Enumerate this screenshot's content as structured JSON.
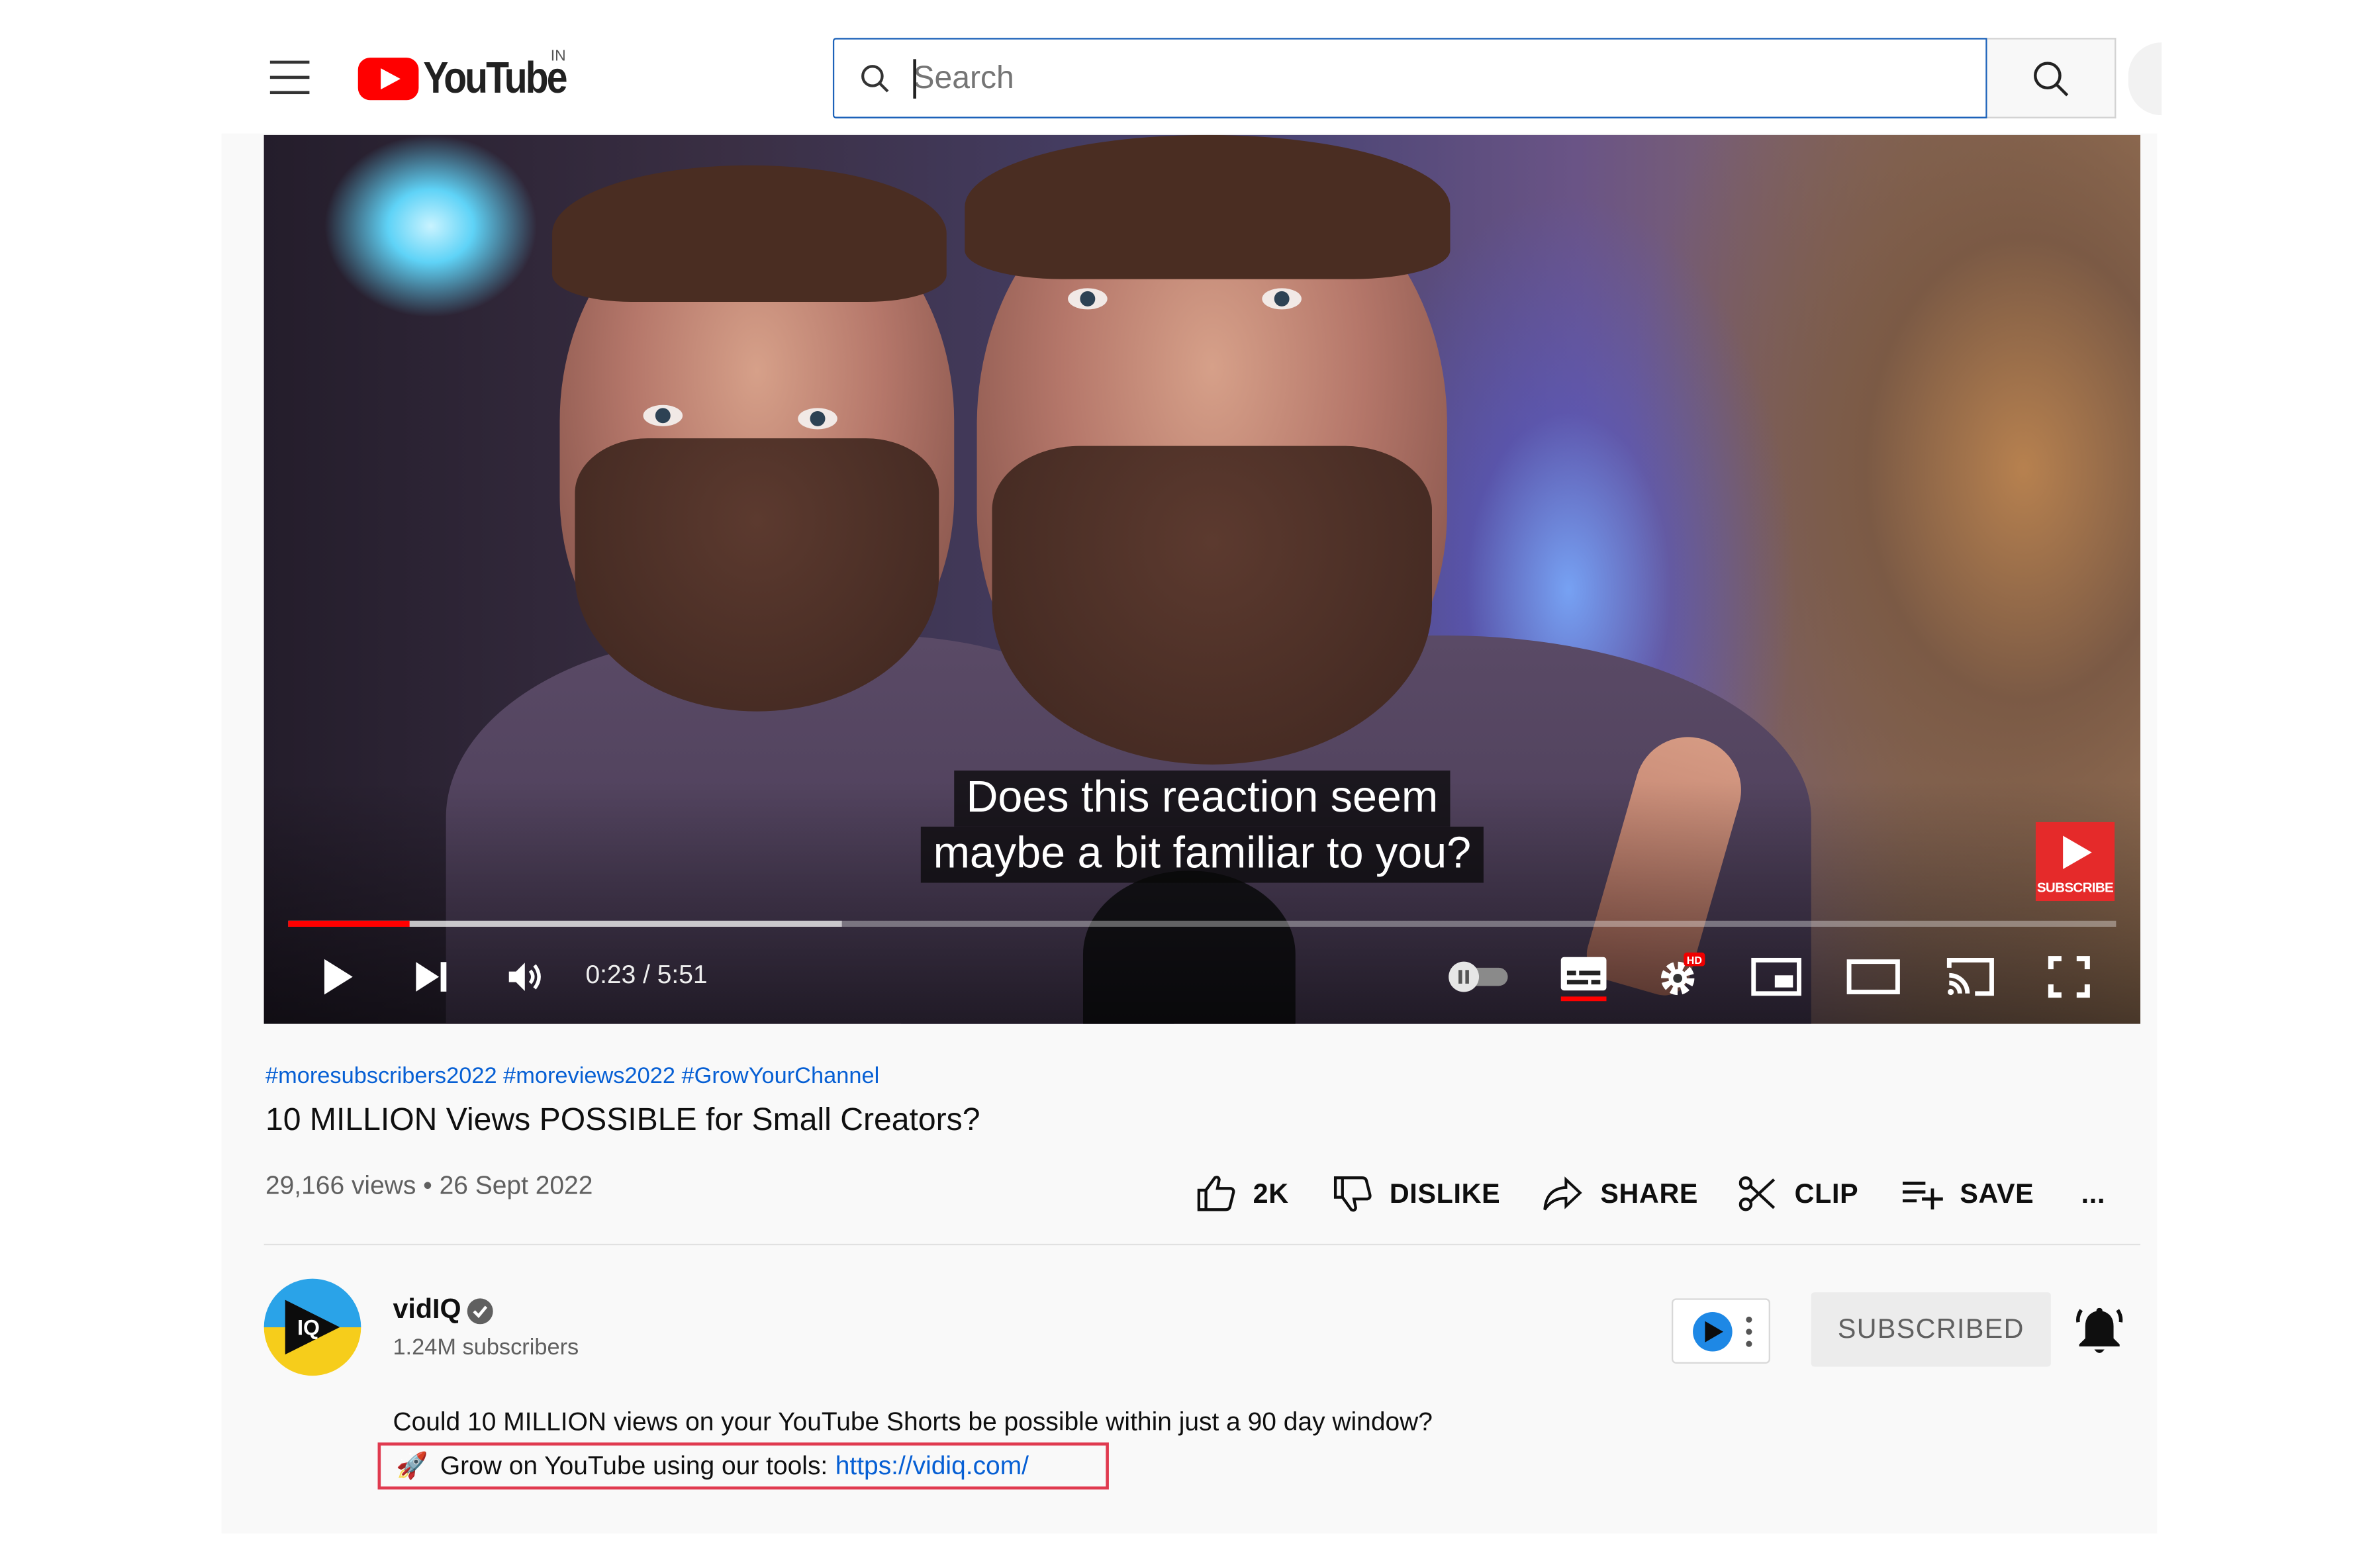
{
  "header": {
    "logo_text": "YouTube",
    "country_code": "IN",
    "search_placeholder": "Search"
  },
  "player": {
    "captions": [
      "Does this reaction seem",
      "maybe a bit familiar to you?"
    ],
    "subscribe_watermark": "SUBSCRIBE",
    "current_time": "0:23",
    "duration": "5:51",
    "time_display": "0:23 / 5:51",
    "played_fraction": 0.066,
    "buffered_fraction": 0.303,
    "settings_badge": "HD",
    "progress_color": "#ff0000"
  },
  "video": {
    "hashtags": "#moresubscribers2022 #moreviews2022 #GrowYourChannel",
    "title": "10 MILLION Views POSSIBLE for Small Creators?",
    "stats": "29,166 views • 26 Sept 2022"
  },
  "actions": {
    "like_count": "2K",
    "dislike": "DISLIKE",
    "share": "SHARE",
    "clip": "CLIP",
    "save": "SAVE",
    "more": "..."
  },
  "channel": {
    "name": "vidIQ",
    "avatar_text": "IQ",
    "subscribers": "1.24M subscribers",
    "subscribed_label": "SUBSCRIBED"
  },
  "description": {
    "line1": "Could 10 MILLION views on your YouTube Shorts be possible within just a 90 day window?",
    "line2_emoji": "🚀",
    "line2_text": "Grow on YouTube using our tools:",
    "line2_link": "https://vidiq.com/"
  },
  "colors": {
    "link_blue": "#065fd4",
    "brand_red": "#ff0000",
    "highlight_box": "#e03a4f"
  }
}
